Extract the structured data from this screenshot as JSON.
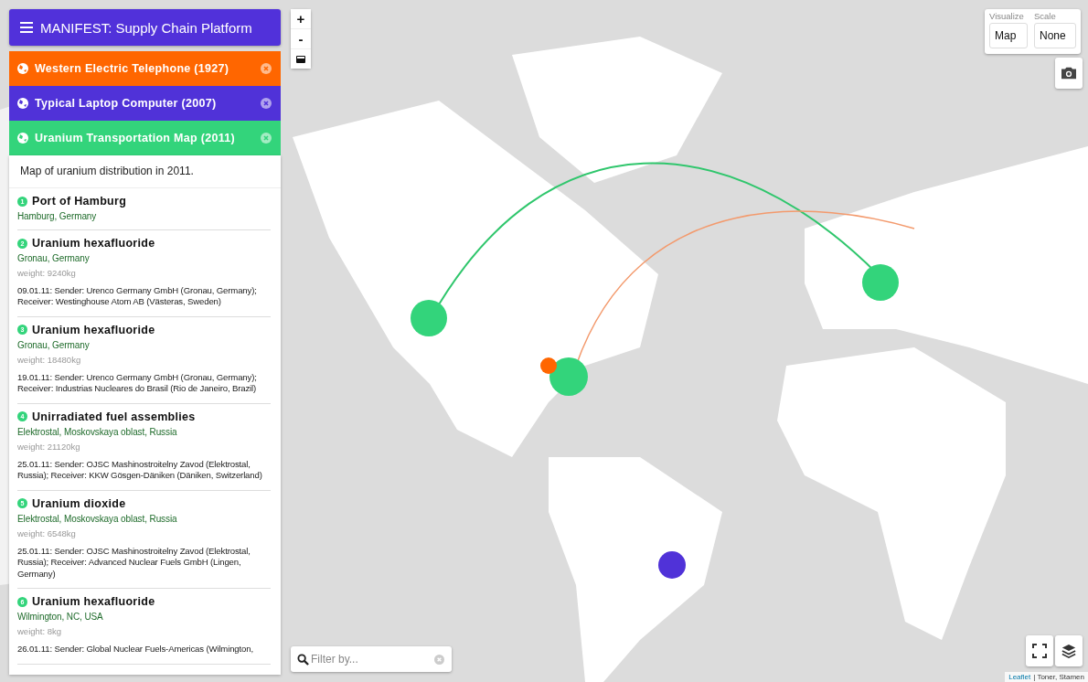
{
  "app": {
    "title": "MANIFEST: Supply Chain Platform"
  },
  "chains": [
    {
      "title": "Western Electric Telephone (1927)",
      "color": "#ff6600"
    },
    {
      "title": "Typical Laptop Computer (2007)",
      "color": "#5032d8"
    },
    {
      "title": "Uranium Transportation Map (2011)",
      "color": "#33d47b"
    }
  ],
  "description": "Map of uranium distribution in 2011.",
  "items": [
    {
      "number": "1",
      "title": "Port of Hamburg",
      "place": "Hamburg, Germany"
    },
    {
      "number": "2",
      "title": "Uranium hexafluoride",
      "place": "Gronau, Germany",
      "weight": "weight: 9240kg",
      "note": "09.01.11: Sender: Urenco Germany GmbH (Gronau, Germany); Receiver: Westinghouse Atom AB (Västeras, Sweden)"
    },
    {
      "number": "3",
      "title": "Uranium hexafluoride",
      "place": "Gronau, Germany",
      "weight": "weight: 18480kg",
      "note": "19.01.11: Sender: Urenco Germany GmbH (Gronau, Germany); Receiver: Industrias Nucleares do Brasil (Rio de Janeiro, Brazil)"
    },
    {
      "number": "4",
      "title": "Unirradiated fuel assemblies",
      "place": "Elektrostal, Moskovskaya oblast, Russia",
      "weight": "weight: 21120kg",
      "note": "25.01.11: Sender: OJSC Mashinostroitelny Zavod (Elektrostal, Russia); Receiver: KKW Gösgen-Däniken (Däniken, Switzerland)"
    },
    {
      "number": "5",
      "title": "Uranium dioxide",
      "place": "Elektrostal, Moskovskaya oblast, Russia",
      "weight": "weight: 6548kg",
      "note": "25.01.11: Sender: OJSC Mashinostroitelny Zavod (Elektrostal, Russia); Receiver: Advanced Nuclear Fuels GmbH (Lingen, Germany)"
    },
    {
      "number": "6",
      "title": "Uranium hexafluoride",
      "place": "Wilmington, NC, USA",
      "weight": "weight: 8kg",
      "note": "26.01.11: Sender: Global Nuclear Fuels-Americas (Wilmington,"
    }
  ],
  "zoom": {
    "in": "+",
    "out": "-"
  },
  "visualize": {
    "label": "Visualize",
    "value": "Map"
  },
  "scale": {
    "label": "Scale",
    "value": "None"
  },
  "filter": {
    "placeholder": "Filter by..."
  },
  "attribution": {
    "link": "Leaflet",
    "text": "| Toner, Stamen"
  }
}
